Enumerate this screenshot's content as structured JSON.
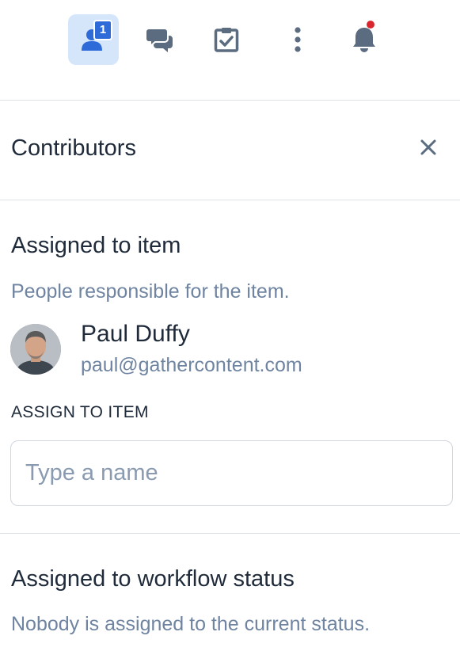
{
  "toolbar": {
    "contributors_badge": "1"
  },
  "header": {
    "title": "Contributors"
  },
  "assigned_item": {
    "title": "Assigned to item",
    "subtitle": "People responsible for the item.",
    "person": {
      "name": "Paul Duffy",
      "email": "paul@gathercontent.com"
    },
    "assign_label": "ASSIGN TO ITEM",
    "input_placeholder": "Type a name"
  },
  "assigned_workflow": {
    "title": "Assigned to workflow status",
    "subtitle": "Nobody is assigned to the current status."
  },
  "colors": {
    "accent": "#2f6ad9",
    "active_bg": "#d5e6fb",
    "icon": "#5b6b80",
    "muted_text": "#6f84a1",
    "notification_dot": "#d9262e"
  },
  "icons": [
    "contributors-icon",
    "comments-icon",
    "tasks-icon",
    "more-icon",
    "notifications-icon",
    "close-icon"
  ]
}
